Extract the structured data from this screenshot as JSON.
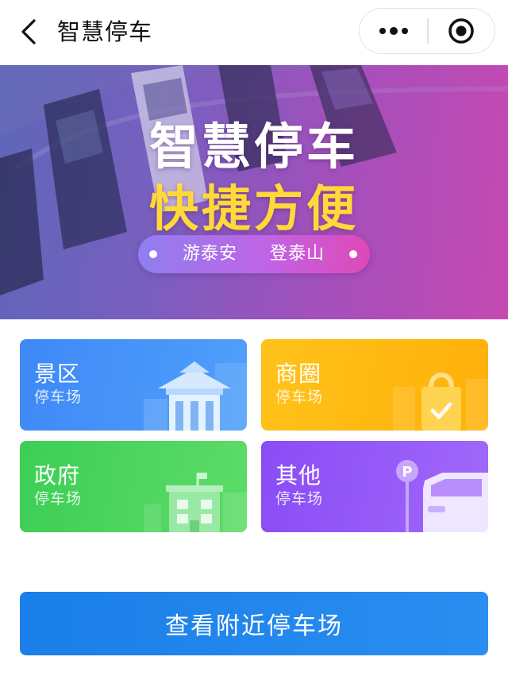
{
  "nav": {
    "title": "智慧停车",
    "back_icon": "chevron-left-icon",
    "more_icon": "more-dots-icon",
    "close_icon": "target-close-icon"
  },
  "banner": {
    "title": "智慧停车",
    "slogan": "快捷方便",
    "tagline_left": "游泰安",
    "tagline_right": "登泰山",
    "colors": {
      "title": "#ffffff",
      "slogan": "#ffd83a"
    }
  },
  "categories": [
    {
      "title": "景区",
      "subtitle": "停车场",
      "icon": "temple-icon",
      "color": "#4a95f9"
    },
    {
      "title": "商圈",
      "subtitle": "停车场",
      "icon": "shopping-bag-icon",
      "color": "#ffbb12"
    },
    {
      "title": "政府",
      "subtitle": "停车场",
      "icon": "government-building-icon",
      "color": "#4cd55e"
    },
    {
      "title": "其他",
      "subtitle": "停车场",
      "icon": "parking-car-icon",
      "color": "#955af8"
    }
  ],
  "actions": {
    "nearby_label": "查看附近停车场",
    "color": "#1f84ec"
  }
}
